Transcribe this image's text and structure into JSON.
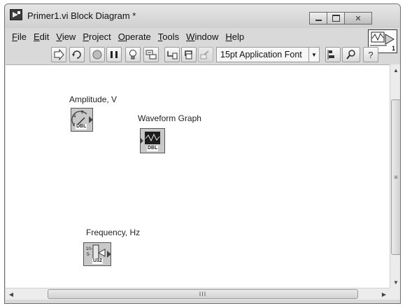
{
  "window": {
    "title": "Primer1.vi Block Diagram *",
    "controls": {
      "minimize": "",
      "maximize": "",
      "close": "✕"
    }
  },
  "menu": [
    {
      "key": "F",
      "rest": "ile"
    },
    {
      "key": "E",
      "rest": "dit"
    },
    {
      "key": "V",
      "rest": "iew"
    },
    {
      "key": "P",
      "rest": "roject"
    },
    {
      "key": "O",
      "rest": "perate"
    },
    {
      "key": "T",
      "rest": "ools"
    },
    {
      "key": "W",
      "rest": "indow"
    },
    {
      "key": "H",
      "rest": "elp"
    }
  ],
  "toolbar": {
    "font": "15pt Application Font",
    "help": "?"
  },
  "vi_icon": {
    "number": "1"
  },
  "nodes": {
    "amplitude": {
      "label": "Amplitude, V",
      "type": "DBL"
    },
    "waveform": {
      "label": "Waveform Graph",
      "type": "DBL"
    },
    "frequency": {
      "label": "Frequency, Hz",
      "type": "U32"
    }
  },
  "scrollbar": {
    "v_grip": "≡",
    "h_grip": "III"
  }
}
